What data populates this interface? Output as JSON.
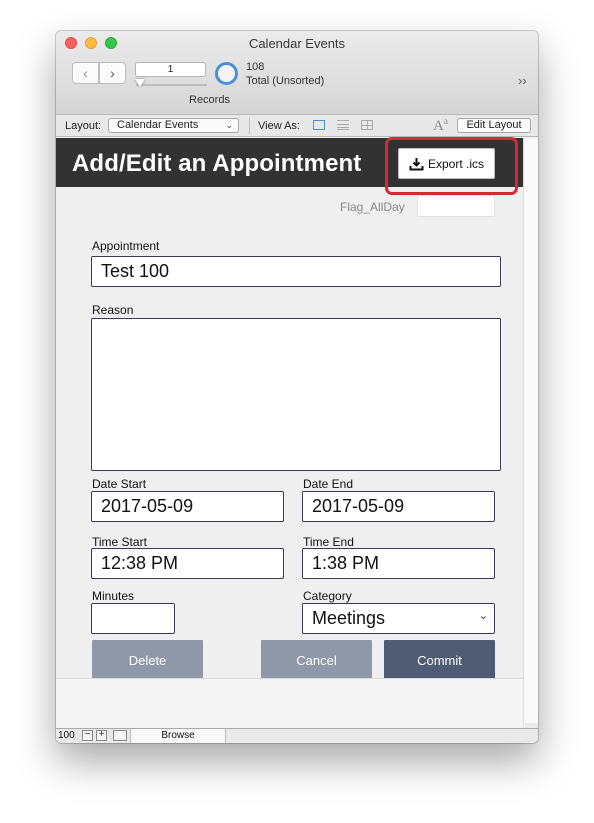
{
  "window": {
    "title": "Calendar Events"
  },
  "toolbar": {
    "current_record": "1",
    "records_label": "Records",
    "total_count": "108",
    "total_label": "Total (Unsorted)",
    "more_icon": "double-chevron-right-icon"
  },
  "layout_bar": {
    "layout_label": "Layout:",
    "layout_value": "Calendar Events",
    "view_as_label": "View As:",
    "views": [
      "form-view-icon",
      "list-view-icon",
      "table-view-icon"
    ],
    "active_view": "form",
    "edit_layout_label": "Edit Layout"
  },
  "form": {
    "title": "Add/Edit an Appointment",
    "export_label": "Export .ics",
    "flag_allday_label": "Flag_AllDay",
    "flag_allday_value": "",
    "appointment_label": "Appointment",
    "appointment_value": "Test 100",
    "reason_label": "Reason",
    "reason_value": "",
    "date_start_label": "Date Start",
    "date_start_value": "2017-05-09",
    "date_end_label": "Date End",
    "date_end_value": "2017-05-09",
    "time_start_label": "Time Start",
    "time_start_value": "12:38 PM",
    "time_end_label": "Time End",
    "time_end_value": "1:38 PM",
    "minutes_label": "Minutes",
    "minutes_value": "",
    "category_label": "Category",
    "category_value": "Meetings",
    "delete_label": "Delete",
    "cancel_label": "Cancel",
    "commit_label": "Commit"
  },
  "status_bar": {
    "zoom": "100",
    "mode": "Browse"
  },
  "colors": {
    "header_band": "#323232",
    "highlight": "#d32a35",
    "button_secondary": "#8f98a8",
    "button_primary": "#4f5c73",
    "accent": "#4a90d9"
  }
}
